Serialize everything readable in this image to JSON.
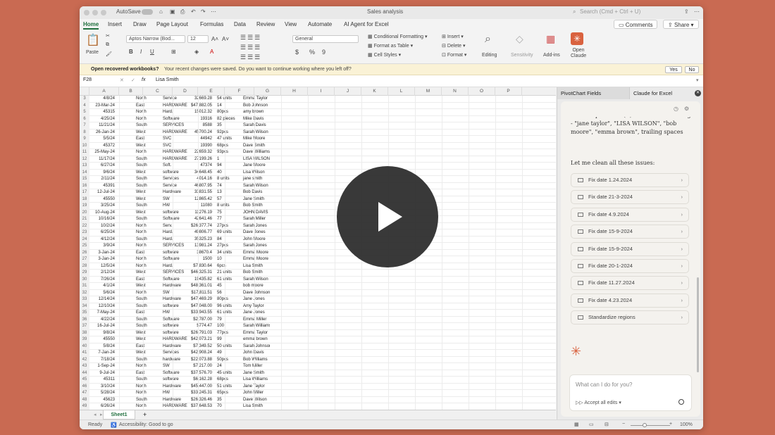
{
  "window": {
    "autosave_label": "AutoSave",
    "doc_title": "Sales analysis",
    "search_placeholder": "Search (Cmd + Ctrl + U)"
  },
  "menu": [
    "Home",
    "Insert",
    "Draw",
    "Page Layout",
    "Formulas",
    "Data",
    "Review",
    "View",
    "Automate",
    "AI Agent for Excel"
  ],
  "menu_actions": {
    "comments": "Comments",
    "share": "Share"
  },
  "ribbon": {
    "paste": "Paste",
    "font_name": "Aptos Narrow (Bod...",
    "font_size": "12",
    "number_format": "General",
    "conditional_formatting": "Conditional Formatting",
    "format_as_table": "Format as Table",
    "cell_styles": "Cell Styles",
    "insert": "Insert",
    "delete": "Delete",
    "format": "Format",
    "editing": "Editing",
    "sensitivity": "Sensitivity",
    "addins": "Add-ins",
    "open_claude": "Open Claude"
  },
  "notification": {
    "title": "Open recovered workbooks?",
    "message": "Your recent changes were saved. Do you want to continue working where you left off?",
    "yes": "Yes",
    "no": "No"
  },
  "formula_bar": {
    "cell_ref": "F28",
    "fx": "fx",
    "content": "Lisa Smith"
  },
  "columns": [
    "A",
    "B",
    "C",
    "D",
    "E",
    "F",
    "G",
    "H",
    "I",
    "J",
    "K",
    "L",
    "M",
    "N",
    "O",
    "P"
  ],
  "rows": [
    [
      "3",
      "4/8/24",
      "North",
      "Service",
      "32669.28",
      "54 units",
      "Emma Taylor"
    ],
    [
      "4",
      "23-Mar-24",
      "East",
      "HARDWARE",
      "$47,882.05",
      "14",
      "Bob Johnson"
    ],
    [
      "5",
      "45315",
      "North",
      "Hard.",
      "15012.32",
      "80pcs",
      "amy brown"
    ],
    [
      "6",
      "4/25/24",
      "North",
      "Software",
      "19316",
      "82 pieces",
      "Mike Davis"
    ],
    [
      "7",
      "11/21/24",
      "South",
      "SERVICES",
      "8588",
      "35",
      "Sarah Davis"
    ],
    [
      "8",
      "26-Jan-24",
      "West",
      "HARDWARE",
      "45700.24",
      "92pcs",
      "Sarah Wilson"
    ],
    [
      "9",
      "5/5/24",
      "East",
      "SVC",
      "44942",
      "47 units",
      "Mike Moore"
    ],
    [
      "10",
      "45372",
      "West",
      "SVC",
      "19390",
      "68pcs",
      "Dave Smith"
    ],
    [
      "11",
      "25-May-24",
      "North",
      "HARDWARE",
      "22659.32",
      "93pcs",
      "Dave Williams"
    ],
    [
      "12",
      "11/17/24",
      "South",
      "HARDWARE",
      "27199.26",
      "1",
      "LISA WILSON"
    ],
    [
      "13",
      "6/27/24",
      "South",
      "Soft.",
      "47374",
      "94",
      "Jane Moore"
    ],
    [
      "14",
      "9/6/24",
      "West",
      "software",
      "34648.45",
      "40",
      "Lisa Wilson"
    ],
    [
      "15",
      "2/11/24",
      "South",
      "Services",
      "4014.16",
      "8 units",
      "jane smith"
    ],
    [
      "16",
      "45391",
      "South",
      "Service",
      "46807.95",
      "74",
      "Sarah Wilson"
    ],
    [
      "17",
      "12-Jul-24",
      "West",
      "Hardware",
      "33831.55",
      "13",
      "Bob Davis"
    ],
    [
      "18",
      "45550",
      "West",
      "SW",
      "12865.42",
      "57",
      "Jane Smith"
    ],
    [
      "19",
      "3/25/24",
      "South",
      "HW",
      "11080",
      "8 units",
      "Bob Smith"
    ],
    [
      "20",
      "10-Aug-24",
      "West",
      "software",
      "11276.19",
      "75",
      "JOHN DAVIS"
    ],
    [
      "21",
      "10/16/24",
      "South",
      "Software",
      "42641.46",
      "77",
      "Sarah Miller"
    ],
    [
      "22",
      "10/2/24",
      "North",
      "Serv.",
      "$26,377.74",
      "27pcs",
      "Sarah Jones"
    ],
    [
      "23",
      "6/25/24",
      "North",
      "Hard.",
      "49806.77",
      "69 units",
      "Dave Jones"
    ],
    [
      "24",
      "4/12/24",
      "South",
      "Hard.",
      "35325.23",
      "84",
      "John Moore"
    ],
    [
      "25",
      "3/9/24",
      "North",
      "SERVICES",
      "13981.24",
      "27pcs",
      "Sarah Jones"
    ],
    [
      "26",
      "3-Jan-24",
      "East",
      "software",
      "38670.4",
      "34 units",
      "Emma Moore"
    ],
    [
      "27",
      "3-Jan-24",
      "North",
      "Software",
      "1500",
      "10",
      "Emma Moore"
    ],
    [
      "28",
      "12/5/24",
      "North",
      "Hard.",
      "$7,830.64",
      "6pcs",
      "Lisa Smith"
    ],
    [
      "29",
      "2/12/24",
      "West",
      "SERVICES",
      "$46,325.31",
      "21 units",
      "Bob Smith"
    ],
    [
      "30",
      "7/26/24",
      "East",
      "Software",
      "19435.82",
      "61 units",
      "Sarah Wilson"
    ],
    [
      "31",
      "4/1/24",
      "West",
      "Hardware",
      "$48,361.01",
      "45",
      "bob moore"
    ],
    [
      "32",
      "5/6/24",
      "North",
      "SW",
      "$17,811.51",
      "56",
      "Dave Johnson"
    ],
    [
      "33",
      "12/14/24",
      "South",
      "Hardware",
      "$47,469.29",
      "80pcs",
      "Jane Jones"
    ],
    [
      "34",
      "12/10/24",
      "South",
      "software",
      "$47,048.00",
      "96 units",
      "Amy Taylor"
    ],
    [
      "35",
      "7-May-24",
      "East",
      "HW",
      "$33,943.55",
      "61 units",
      "Jane Jones"
    ],
    [
      "36",
      "4/22/24",
      "South",
      "Software",
      "$2,787.00",
      "79",
      "Emma Miller"
    ],
    [
      "37",
      "16-Jul-24",
      "South",
      "software",
      "$774.47",
      "100",
      "Sarah Williams"
    ],
    [
      "38",
      "9/8/24",
      "West",
      "software",
      "$26,791.03",
      "77pcs",
      "Emma Taylor"
    ],
    [
      "39",
      "45550",
      "West",
      "HARDWARE",
      "$42,073.21",
      "99",
      "emma brown"
    ],
    [
      "40",
      "5/8/24",
      "East",
      "Hardware",
      "$7,349.52",
      "50 units",
      "Sarah Johnson"
    ],
    [
      "41",
      "7-Jan-24",
      "West",
      "Services",
      "$42,908.24",
      "49",
      "John Davis"
    ],
    [
      "42",
      "7/18/24",
      "South",
      "hardware",
      "$22,073.88",
      "50pcs",
      "Bob Williams"
    ],
    [
      "43",
      "1-Sep-24",
      "North",
      "SW",
      "$7,217.00",
      "24",
      "Tom Miller"
    ],
    [
      "44",
      "9-Jul-24",
      "East",
      "Software",
      "$37,576.70",
      "45 units",
      "Jane Smith"
    ],
    [
      "45",
      "45311",
      "South",
      "software",
      "$6,162.28",
      "68pcs",
      "Lisa Williams"
    ],
    [
      "46",
      "3/10/24",
      "North",
      "Hardware",
      "$45,447.00",
      "51 units",
      "Jane Taylor"
    ],
    [
      "47",
      "5/28/24",
      "North",
      "HW",
      "$33,245.31",
      "65pcs",
      "John Miller"
    ],
    [
      "48",
      "45623",
      "South",
      "Hardware",
      "$26,326.46",
      "35",
      "Dave Wilson"
    ],
    [
      "49",
      "6/26/24",
      "North",
      "HARDWARE",
      "$37,648.53",
      "70",
      "Lisa Smith"
    ]
  ],
  "sheet_tab": "Sheet1",
  "status": {
    "ready": "Ready",
    "accessibility": "Accessibility: Good to go",
    "zoom": "100%"
  },
  "pane": {
    "tab1": "PivotChart Fields",
    "tab2": "Claude for Excel",
    "msg_partial": "Sales Rep column (F): Inconsistent casing - \"jane taylor\", \"LISA WILSON\", \"bob moore\", \"emma brown\", trailing spaces",
    "msg2": "Let me clean all these issues:",
    "actions": [
      "Fix date 1.24.2024",
      "Fix date 21-3-2024",
      "Fix date 4.9.2024",
      "Fix date 15-9-2024",
      "Fix date 15-9-2024",
      "Fix date 20-1-2024",
      "Fix date 11.27.2024",
      "Fix date 4.23.2024",
      "Standardize regions"
    ],
    "input_placeholder": "What can I do for you?",
    "accept_edits": "Accept all edits"
  },
  "colors": {
    "accent": "#1e6e3c",
    "claude": "#d9623f",
    "background": "#c96a52"
  }
}
